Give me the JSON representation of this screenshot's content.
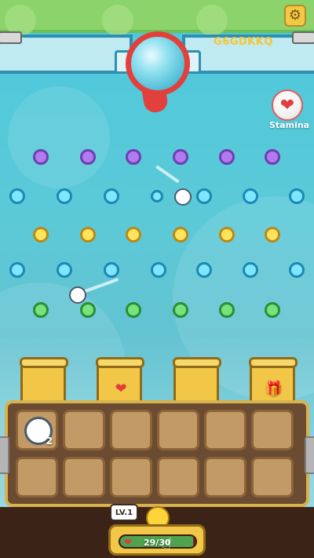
{
  "header": {
    "code": "G6GDKKQ"
  },
  "stamina": {
    "label": "Stamina"
  },
  "grid": {
    "slots_top": [
      {
        "occupied": true,
        "count": "2"
      },
      {
        "occupied": false,
        "count": ""
      },
      {
        "occupied": false,
        "count": ""
      },
      {
        "occupied": false,
        "count": ""
      },
      {
        "occupied": false,
        "count": ""
      },
      {
        "occupied": false,
        "count": ""
      }
    ],
    "slots_bottom": [
      {
        "occupied": false,
        "count": ""
      },
      {
        "occupied": false,
        "count": ""
      },
      {
        "occupied": false,
        "count": ""
      },
      {
        "occupied": false,
        "count": ""
      },
      {
        "occupied": false,
        "count": ""
      },
      {
        "occupied": false,
        "count": ""
      }
    ]
  },
  "level": {
    "label": "LV.1"
  },
  "energy": {
    "value": "29/30",
    "fraction": 0.966
  },
  "colors": {
    "sky_top": "#4cc9dc",
    "header_green": "#8bd36a",
    "accent_red": "#e2403c",
    "code_yellow": "#f7c52a"
  },
  "icons": {
    "settings": "gear-icon",
    "stamina": "heart-icon",
    "hand": "hand-pointer-icon",
    "bucket2": "heart-icon",
    "bucket4": "mystery-box-icon"
  }
}
